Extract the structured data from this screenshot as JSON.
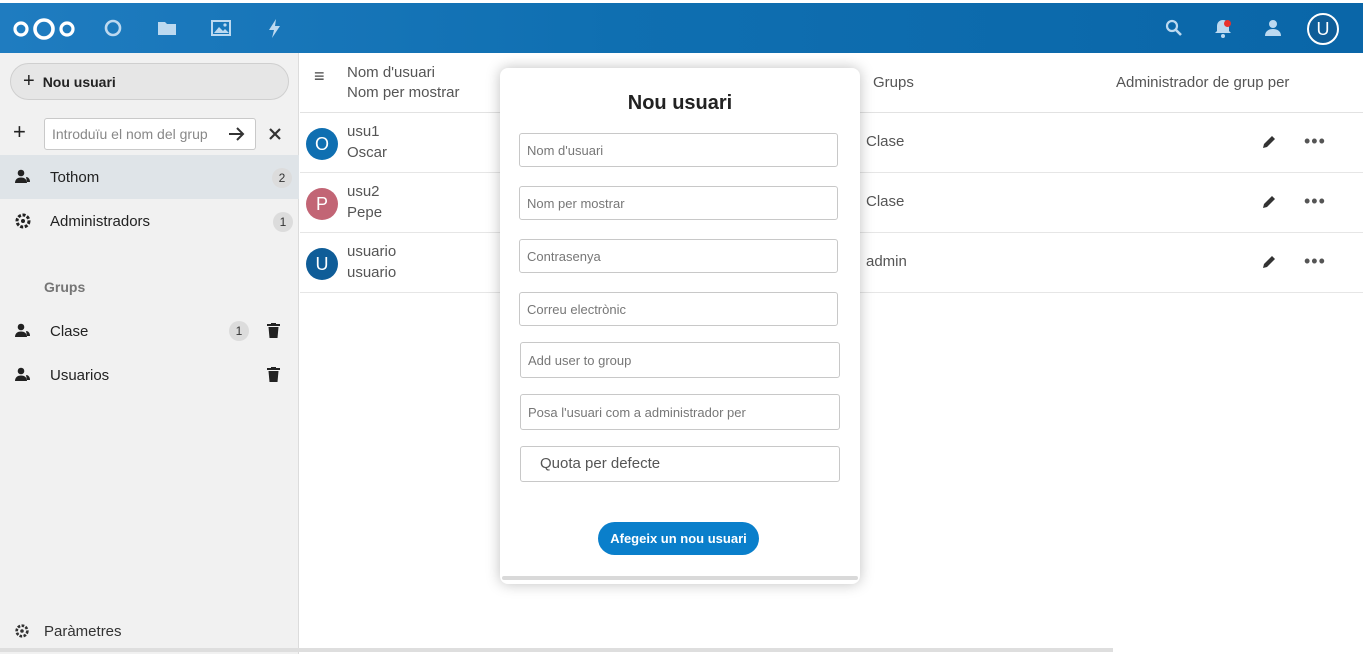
{
  "header": {
    "icons": [
      "nextcloud-logo-icon",
      "dashboard-icon",
      "files-icon",
      "photos-icon",
      "activity-icon",
      "search-icon",
      "notifications-icon",
      "contacts-icon"
    ],
    "avatar_letter": "U"
  },
  "sidebar": {
    "new_user_label": "Nou usuari",
    "group_name_placeholder": "Introduïu el nom del grup",
    "groups_caption": "Grups",
    "special_groups": [
      {
        "label": "Tothom",
        "count": "2"
      },
      {
        "label": "Administradors",
        "count": "1"
      }
    ],
    "groups": [
      {
        "label": "Clase",
        "count": "1"
      },
      {
        "label": "Usuarios",
        "count": ""
      }
    ],
    "settings_label": "Paràmetres"
  },
  "table": {
    "col_username": "Nom d'usuari",
    "col_displayname": "Nom per mostrar",
    "col_groups": "Grups",
    "col_subadmin": "Administrador de grup per",
    "rows": [
      {
        "avatar": "O",
        "avatar_color": "#0f6fb1",
        "username": "usu1",
        "displayname": "Oscar",
        "groups": "Clase"
      },
      {
        "avatar": "P",
        "avatar_color": "#c26575",
        "username": "usu2",
        "displayname": "Pepe",
        "groups": "Clase"
      },
      {
        "avatar": "U",
        "avatar_color": "#0f5d98",
        "username": "usuario",
        "displayname": "usuario",
        "groups": "admin"
      }
    ]
  },
  "modal": {
    "title": "Nou usuari",
    "username_placeholder": "Nom d'usuari",
    "displayname_placeholder": "Nom per mostrar",
    "password_placeholder": "Contrasenya",
    "email_placeholder": "Correu electrònic",
    "groups_placeholder": "Add user to group",
    "subadmin_placeholder": "Posa l'usuari com a administrador per",
    "quota_value": "Quota per defecte",
    "submit_label": "Afegeix un nou usuari"
  },
  "colors": {
    "header": "#0f6fb1",
    "primary": "#0a7fcb"
  }
}
